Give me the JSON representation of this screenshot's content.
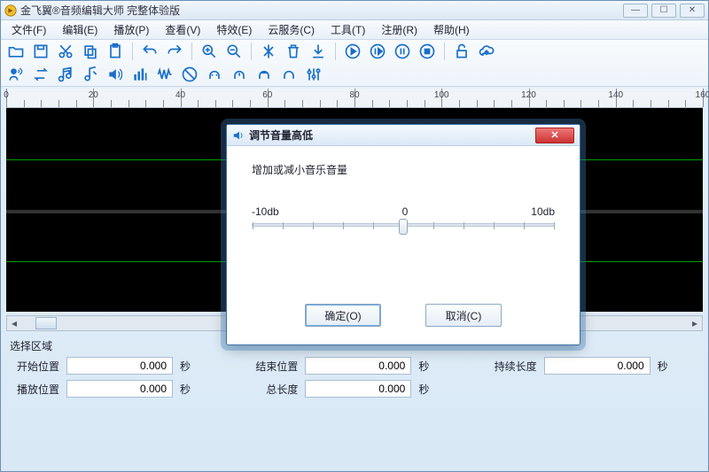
{
  "titlebar": {
    "title": "金飞翼®音频编辑大师 完整体验版"
  },
  "menu": {
    "file": "文件(F)",
    "edit": "编辑(E)",
    "play": "播放(P)",
    "view": "查看(V)",
    "effect": "特效(E)",
    "cloud": "云服务(C)",
    "tools": "工具(T)",
    "reg": "注册(R)",
    "help": "帮助(H)"
  },
  "ruler": {
    "labels": [
      "0",
      "20",
      "40",
      "60",
      "80",
      "100",
      "120",
      "140",
      "160"
    ]
  },
  "selection_section": "选择区域",
  "fields": {
    "start_label": "开始位置",
    "start_value": "0.000",
    "start_unit": "秒",
    "end_label": "结束位置",
    "end_value": "0.000",
    "end_unit": "秒",
    "dur_label": "持续长度",
    "dur_value": "0.000",
    "dur_unit": "秒",
    "play_label": "播放位置",
    "play_value": "0.000",
    "play_unit": "秒",
    "total_label": "总长度",
    "total_value": "0.000",
    "total_unit": "秒"
  },
  "dialog": {
    "title": "调节音量高低",
    "instruction": "增加或减小音乐音量",
    "slider": {
      "min_label": "-10db",
      "mid_label": "0",
      "max_label": "10db"
    },
    "ok": "确定(O)",
    "cancel": "取消(C)"
  }
}
